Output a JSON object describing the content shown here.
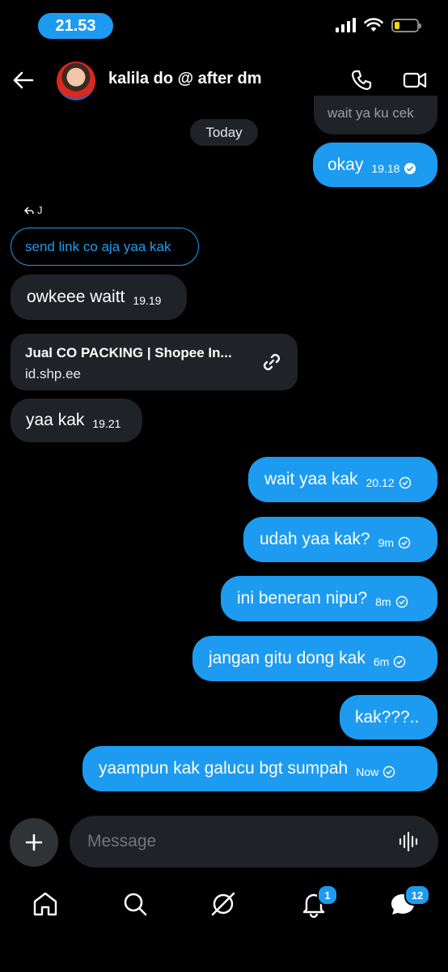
{
  "status_bar": {
    "time": "21.53"
  },
  "header": {
    "contact_name": "kalila do @ after dm"
  },
  "messages": {
    "partial_top": "wait ya ku cek",
    "date_divider": "Today",
    "m1": {
      "text": "okay",
      "time": "19.18"
    },
    "reply_indicator": "J",
    "reply_quote": "send link co aja yaa kak",
    "m2": {
      "text": "owkeee waitt",
      "time": "19.19"
    },
    "link_card": {
      "title": "Jual CO PACKING | Shopee In...",
      "url": "id.shp.ee"
    },
    "m3": {
      "text": "yaa kak",
      "time": "19.21"
    },
    "m4": {
      "text": "wait yaa kak",
      "time": "20.12"
    },
    "m5": {
      "text": "udah yaa kak?",
      "time": "9m"
    },
    "m6": {
      "text": "ini beneran nipu?",
      "time": "8m"
    },
    "m7": {
      "text": "jangan gitu dong kak",
      "time": "6m"
    },
    "m8": {
      "text": "kak???.."
    },
    "m9": {
      "text": "yaampun kak galucu bgt sumpah",
      "time": "Now"
    }
  },
  "composer": {
    "placeholder": "Message"
  },
  "nav": {
    "notifications_badge": "1",
    "messages_badge": "12"
  },
  "colors": {
    "accent": "#1d9bf0",
    "incoming_bubble": "#1f2226",
    "background": "#000000"
  }
}
